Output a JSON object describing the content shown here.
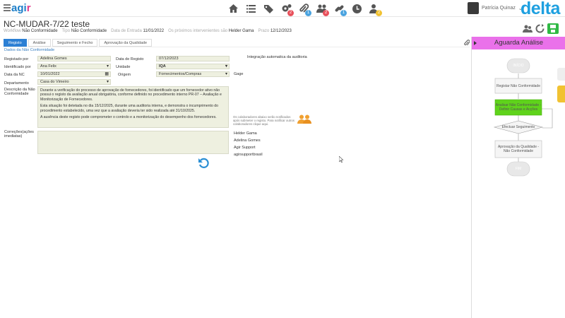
{
  "topbar": {
    "logo": "agir",
    "brand": "delta",
    "user_name": "Patrícia Quinaz",
    "icons": [
      {
        "name": "home-icon",
        "badge": ""
      },
      {
        "name": "list-icon",
        "badge": ""
      },
      {
        "name": "tags-icon",
        "badge": ""
      },
      {
        "name": "gears-icon",
        "badge": "2"
      },
      {
        "name": "paperclip-icon",
        "badge": "1"
      },
      {
        "name": "users-icon",
        "badge": "2"
      },
      {
        "name": "link-icon",
        "badge": "1"
      },
      {
        "name": "clock-icon",
        "badge": ""
      },
      {
        "name": "user-alert-icon",
        "badge": "2"
      }
    ],
    "badge_colors": {
      "2": "#e8505b",
      "1": "#4aa3df"
    }
  },
  "record": {
    "title": "NC-MUDAR-7/22 teste",
    "meta": [
      {
        "label": "Workflow",
        "value": "Não Conformidade"
      },
      {
        "label": "Tipo",
        "value": "Não Conformidade"
      },
      {
        "label": "Data de Entrada",
        "value": "11/01/2022"
      },
      {
        "label": "Os próximos intervenientes são",
        "value": "Helder Gama"
      },
      {
        "label": "Prazo",
        "value": "12/12/2023"
      }
    ]
  },
  "tabs": [
    "Registo",
    "Análise",
    "Seguimento e Fecho",
    "Aprovação da Qualidade"
  ],
  "form": {
    "section": "Dados da Não Conformidade",
    "registado_por_label": "Registado por",
    "registado_por": "Adelina Gomes",
    "data_registo_label": "Data de Registo",
    "data_registo": "07/12/2023",
    "identificado_por_label": "Identificado por",
    "identificado_por": "Ana Felix",
    "unidade_label": "Unidade",
    "unidade": "IQA",
    "data_nc_label": "Data da NC",
    "data_nc": "10/01/2022",
    "origem_label": "Origem",
    "origem": "Fornecimentos/Compras",
    "departamento_label": "Departamento",
    "departamento": "Casa do Vimeiro",
    "descricao_label": "Descrição da Não Conformidade",
    "descricao": [
      "Durante a verificação do processo de aprovação de fornecedores, foi identificado que um fornecedor ativo não possui o registo da avaliação anual obrigatória, conforme definido no procedimento interno PR-07 – Avaliação e Monitorização de Fornecedores.",
      "Esta situação foi detetada no dia 15/12/2025, durante uma auditoria interna, e demonstra o incumprimento do procedimento estabelecido, uma vez que a avaliação deveria ter sido realizada até 31/10/2025.",
      "A ausência deste registo pode comprometer o controlo e a monitorização do desempenho dos fornecedores."
    ],
    "correcoes_label": "Correções(ações imediatas)",
    "integracao": "Integração automatica da auditoria",
    "gage": "Gage",
    "collab_info": "Os colaboradores abaixo serão notificados após submeter o registo. Para notificar outros colaboradores clique aqui.",
    "collaborators": [
      "Helder Gama",
      "Adelina Gomes",
      "Agir Support",
      "agirsupportbrasil"
    ]
  },
  "side": {
    "status": "Aguarda Análise",
    "flow": {
      "start": "INÍCIO",
      "step1": "Registar Não Conformidade",
      "step2": "Analisar Não Conformidade - Definir Causas e Acções",
      "step3": "Efectuar Seguimento",
      "step4": "Aprovação da Qualidade - Não Conformidade",
      "end": "FIM"
    },
    "active_color": "#5fd31b"
  }
}
